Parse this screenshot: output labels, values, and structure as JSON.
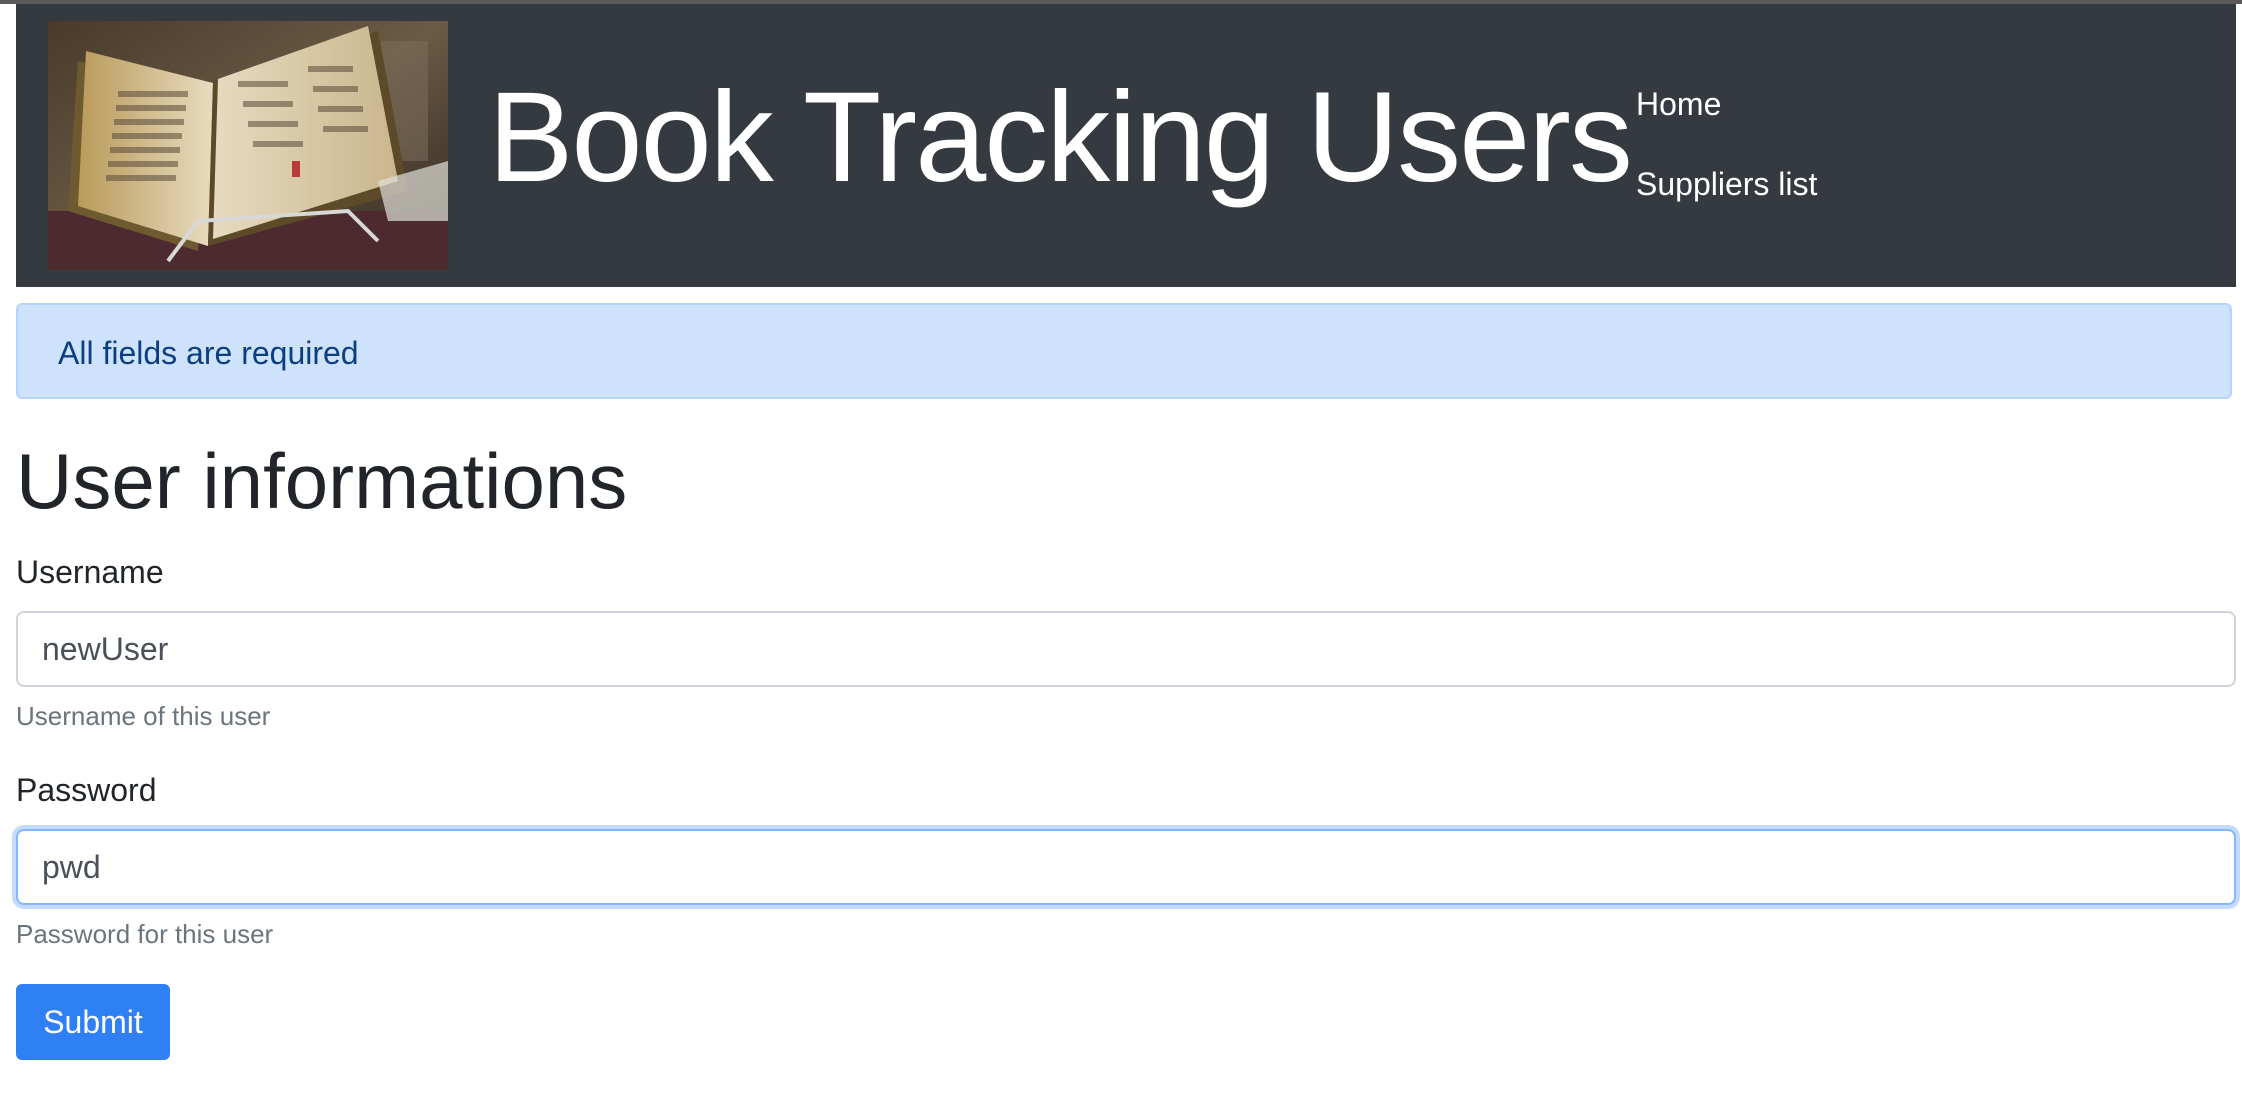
{
  "header": {
    "logo_icon": "open-book-image",
    "title": "Book Tracking Users",
    "nav": [
      {
        "label": "Home"
      },
      {
        "label": "Suppliers list"
      }
    ],
    "background_color": "#343a40"
  },
  "alert": {
    "text": "All fields are required",
    "background_color": "#cfe2fb",
    "text_color": "#0b3f7f"
  },
  "main": {
    "title": "User informations",
    "fields": [
      {
        "label": "Username",
        "value": "newUser",
        "help": "Username of this user"
      },
      {
        "label": "Password",
        "value": "pwd",
        "help": "Password for this user"
      }
    ],
    "submit_label": "Submit",
    "accent_color": "#2f7ff5"
  }
}
